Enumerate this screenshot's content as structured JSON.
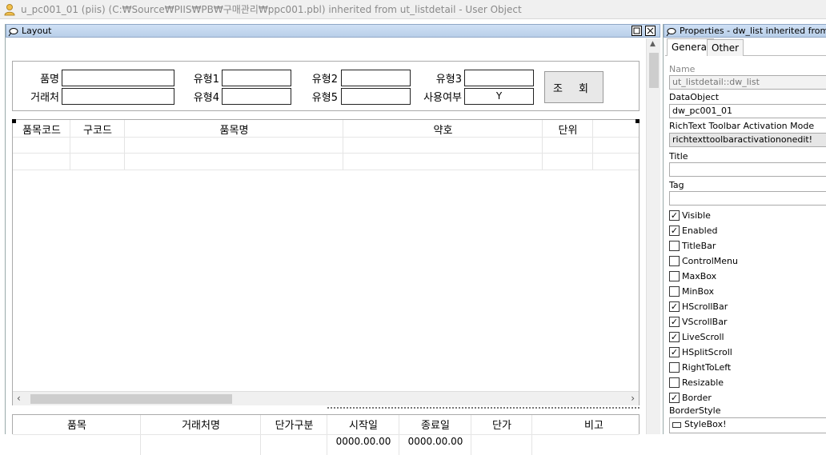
{
  "window": {
    "title": "u_pc001_01 (piis) (C:₩Source₩PIIS₩PB₩구매관리₩ppc001.pbl) inherited from ut_listdetail - User Object"
  },
  "layout_panel": {
    "title": "Layout",
    "restore_icon": "restore-icon",
    "close_icon": "close-icon",
    "conditions": {
      "item_name_label": "품명",
      "vendor_label": "거래처",
      "type1_label": "유형1",
      "type2_label": "유형2",
      "type3_label": "유형3",
      "type4_label": "유형4",
      "type5_label": "유형5",
      "use_yn_label": "사용여부",
      "use_yn_value": "Y",
      "search_button": "조 회"
    },
    "grid_columns": [
      "품목코드",
      "구코드",
      "품목명",
      "약호",
      "단위"
    ],
    "detail_columns": [
      "품목",
      "거래처명",
      "단가구분",
      "시작일",
      "종료일",
      "단가",
      "비고"
    ],
    "detail_values": {
      "start_date": "0000.00.00",
      "end_date": "0000.00.00"
    }
  },
  "properties_panel": {
    "title": "Properties - dw_list  inherited  from  dw",
    "tabs": [
      "General",
      "Other"
    ],
    "name_label": "Name",
    "name_value": "ut_listdetail::dw_list",
    "dataobject_label": "DataObject",
    "dataobject_value": "dw_pc001_01",
    "richtext_label": "RichText Toolbar Activation Mode",
    "richtext_value": "richtexttoolbaractivationonedit!",
    "title_label": "Title",
    "title_value": "",
    "tag_label": "Tag",
    "tag_value": "",
    "checkboxes": [
      {
        "label": "Visible",
        "checked": true
      },
      {
        "label": "Enabled",
        "checked": true
      },
      {
        "label": "TitleBar",
        "checked": false
      },
      {
        "label": "ControlMenu",
        "checked": false
      },
      {
        "label": "MaxBox",
        "checked": false
      },
      {
        "label": "MinBox",
        "checked": false
      },
      {
        "label": "HScrollBar",
        "checked": true
      },
      {
        "label": "VScrollBar",
        "checked": true
      },
      {
        "label": "LiveScroll",
        "checked": true
      },
      {
        "label": "HSplitScroll",
        "checked": true
      },
      {
        "label": "RightToLeft",
        "checked": false
      },
      {
        "label": "Resizable",
        "checked": false
      },
      {
        "label": "Border",
        "checked": true
      }
    ],
    "borderstyle_label": "BorderStyle",
    "borderstyle_value": "StyleBox!"
  },
  "colors": {
    "highlight": "#ffff30",
    "panel_header": "#c4d7ee"
  }
}
